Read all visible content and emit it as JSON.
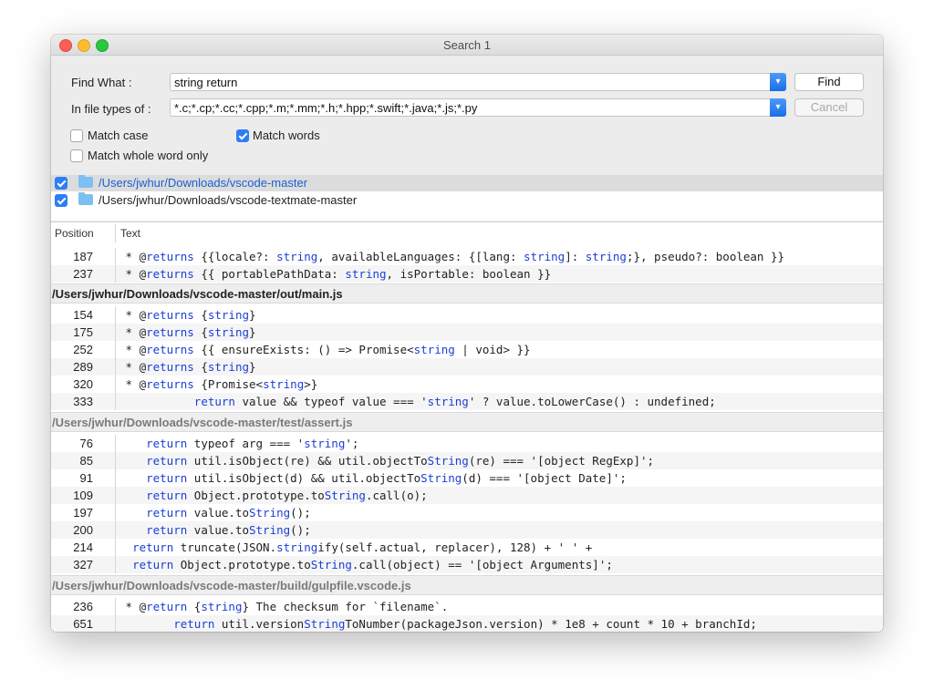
{
  "window": {
    "title": "Search 1"
  },
  "form": {
    "find_label": "Find What :",
    "find_value": "string return",
    "types_label": "In file types of :",
    "types_value": "*.c;*.cp;*.cc;*.cpp;*.m;*.mm;*.h;*.hpp;*.swift;*.java;*.js;*.py",
    "find_button": "Find",
    "cancel_button": "Cancel",
    "match_case": {
      "label": "Match case",
      "checked": false
    },
    "match_words": {
      "label": "Match words",
      "checked": true
    },
    "match_whole": {
      "label": "Match whole word only",
      "checked": false
    }
  },
  "folders": [
    {
      "path": "/Users/jwhur/Downloads/vscode-master",
      "checked": true
    },
    {
      "path": "/Users/jwhur/Downloads/vscode-textmate-master",
      "checked": true
    }
  ],
  "columns": {
    "position": "Position",
    "text": "Text"
  },
  "results": {
    "r1": {
      "pos": "187",
      "a": " * @",
      "b": "returns",
      "c": " {{locale?: ",
      "d": "string",
      "e": ", availableLanguages: {[lang: ",
      "f": "string",
      "g": "]: ",
      "h": "string",
      "i": ";}, pseudo?: boolean }}"
    },
    "r2": {
      "pos": "237",
      "a": " * @",
      "b": "returns",
      "c": " {{ portablePathData: ",
      "d": "string",
      "e": ", isPortable: boolean }}"
    },
    "g1": "/Users/jwhur/Downloads/vscode-master/out/main.js",
    "r3": {
      "pos": "154",
      "a": " * @",
      "b": "returns",
      "c": " {",
      "d": "string",
      "e": "}"
    },
    "r4": {
      "pos": "175",
      "a": " * @",
      "b": "returns",
      "c": " {",
      "d": "string",
      "e": "}"
    },
    "r5": {
      "pos": "252",
      "a": " * @",
      "b": "returns",
      "c": " {{ ensureExists: () => Promise<",
      "d": "string",
      "e": " | void> }}"
    },
    "r6": {
      "pos": "289",
      "a": " * @",
      "b": "returns",
      "c": " {",
      "d": "string",
      "e": "}"
    },
    "r7": {
      "pos": "320",
      "a": " * @",
      "b": "returns",
      "c": " {Promise<",
      "d": "string",
      "e": ">}"
    },
    "r8": {
      "pos": "333",
      "a": "           ",
      "b": "return",
      "c": " value && typeof value === '",
      "d": "string",
      "e": "' ? value.toLowerCase() : undefined;"
    },
    "g2": "/Users/jwhur/Downloads/vscode-master/test/assert.js",
    "r9": {
      "pos": "76",
      "a": "    ",
      "b": "return",
      "c": " typeof arg === '",
      "d": "string",
      "e": "';"
    },
    "r10": {
      "pos": "85",
      "a": "    ",
      "b": "return",
      "c": " util.isObject(re) && util.objectTo",
      "d": "String",
      "e": "(re) === '[object RegExp]';"
    },
    "r11": {
      "pos": "91",
      "a": "    ",
      "b": "return",
      "c": " util.isObject(d) && util.objectTo",
      "d": "String",
      "e": "(d) === '[object Date]';"
    },
    "r12": {
      "pos": "109",
      "a": "    ",
      "b": "return",
      "c": " Object.prototype.to",
      "d": "String",
      "e": ".call(o);"
    },
    "r13": {
      "pos": "197",
      "a": "    ",
      "b": "return",
      "c": " value.to",
      "d": "String",
      "e": "();"
    },
    "r14": {
      "pos": "200",
      "a": "    ",
      "b": "return",
      "c": " value.to",
      "d": "String",
      "e": "();"
    },
    "r15": {
      "pos": "214",
      "a": "  ",
      "b": "return",
      "c": " truncate(JSON.",
      "d": "string",
      "e": "ify(self.actual, replacer), 128) + ' ' +"
    },
    "r16": {
      "pos": "327",
      "a": "  ",
      "b": "return",
      "c": " Object.prototype.to",
      "d": "String",
      "e": ".call(object) == '[object Arguments]';"
    },
    "g3": "/Users/jwhur/Downloads/vscode-master/build/gulpfile.vscode.js",
    "r17": {
      "pos": "236",
      "a": " * @",
      "b": "return",
      "c": " {",
      "d": "string",
      "e": "} The checksum for `filename`."
    },
    "r18": {
      "pos": "651",
      "a": "        ",
      "b": "return",
      "c": " util.version",
      "d": "String",
      "e": "ToNumber(packageJson.version) * 1e8 + count * 10 + branchId;"
    }
  }
}
